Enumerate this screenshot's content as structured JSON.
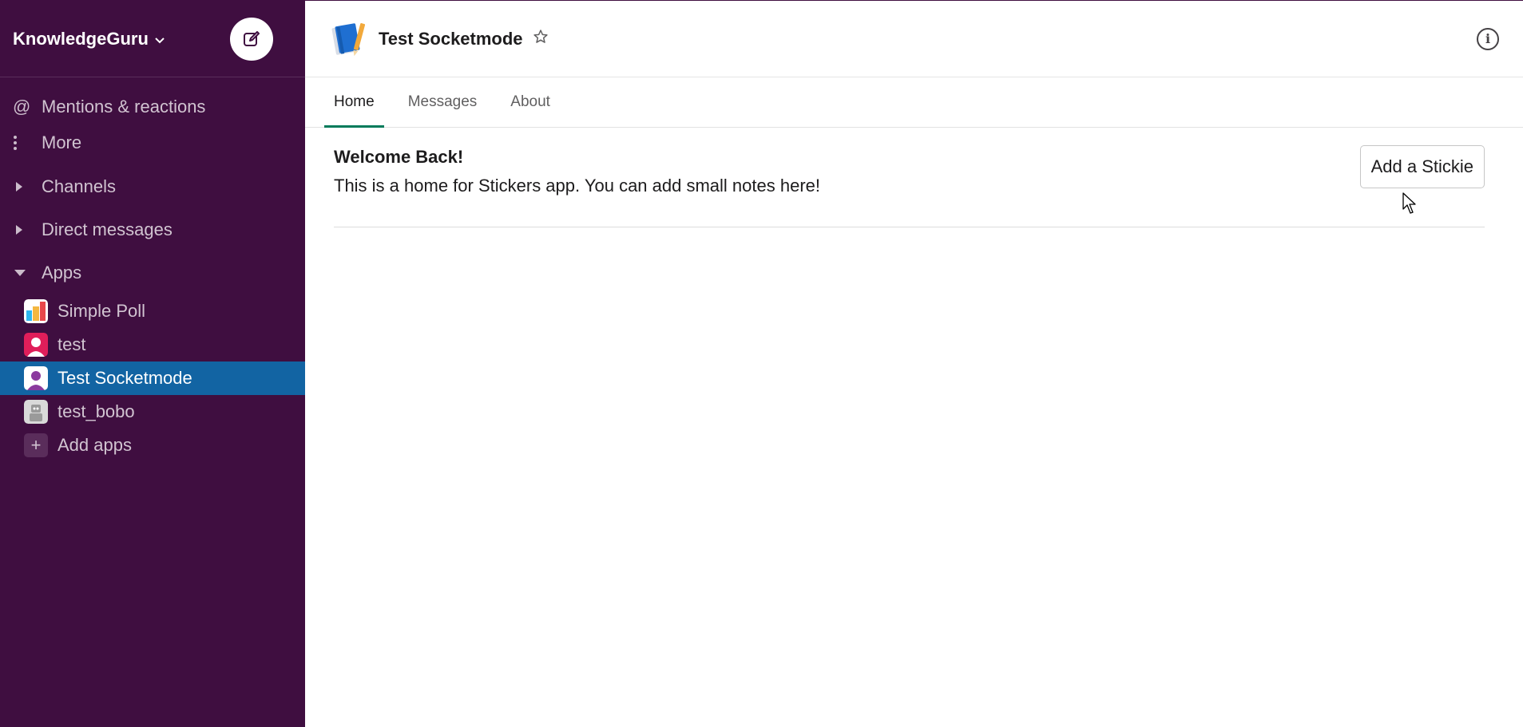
{
  "workspace": {
    "name": "KnowledgeGuru"
  },
  "sidebar": {
    "nav": [
      {
        "label": "Mentions & reactions",
        "icon": "at-icon"
      },
      {
        "label": "More",
        "icon": "more-vertical-icon"
      }
    ],
    "sections": {
      "channels": "Channels",
      "direct_messages": "Direct messages",
      "apps": "Apps"
    },
    "apps": [
      {
        "label": "Simple Poll",
        "icon": "bar-chart-icon"
      },
      {
        "label": "test",
        "icon": "user-avatar-icon"
      },
      {
        "label": "Test Socketmode",
        "icon": "user-avatar-icon",
        "active": true
      },
      {
        "label": "test_bobo",
        "icon": "robot-icon"
      }
    ],
    "add_apps": "Add apps"
  },
  "header": {
    "title": "Test Socketmode",
    "tabs": [
      "Home",
      "Messages",
      "About"
    ],
    "active_tab": "Home"
  },
  "home": {
    "welcome": "Welcome Back!",
    "description": "This is a home for Stickers app. You can add small notes here!",
    "button": "Add a Stickie"
  },
  "colors": {
    "sidebar_bg": "#3f0e40",
    "active_item": "#1264a3",
    "tab_underline": "#007a5a"
  }
}
